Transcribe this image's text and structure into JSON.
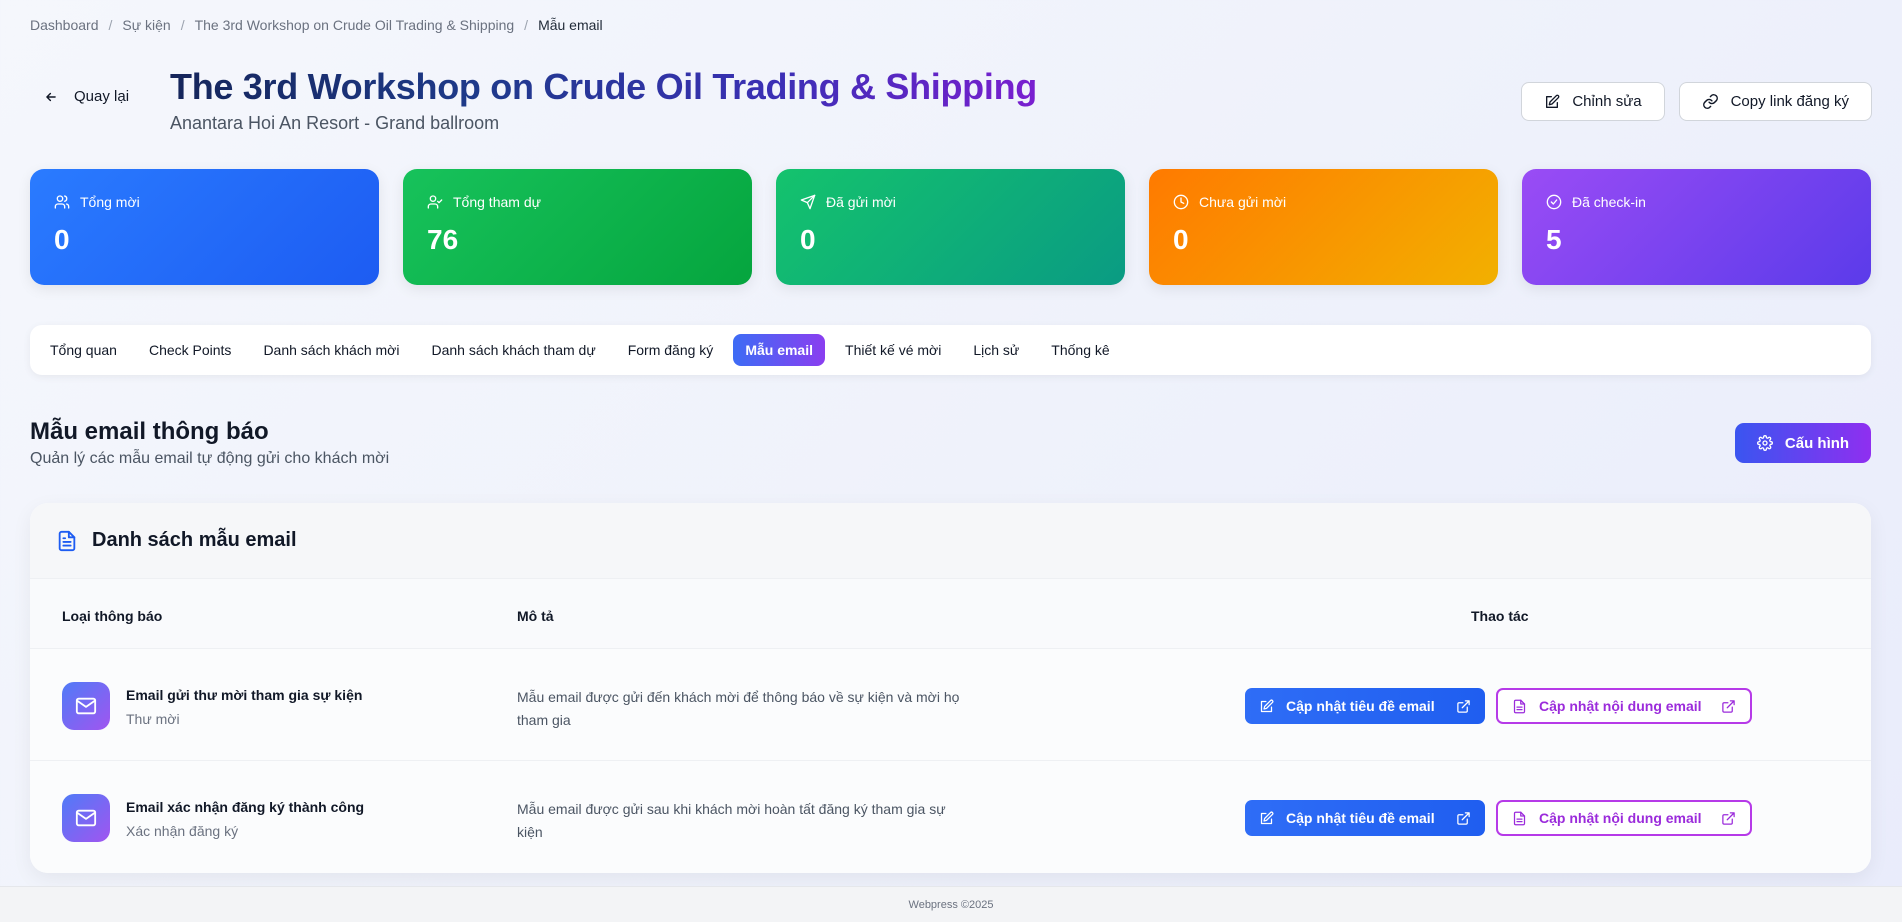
{
  "breadcrumb": [
    "Dashboard",
    "Sự kiện",
    "The 3rd Workshop on Crude Oil Trading & Shipping",
    "Mẫu email"
  ],
  "header": {
    "back_label": "Quay lại",
    "title": "The 3rd Workshop on Crude Oil Trading & Shipping",
    "subtitle": "Anantara Hoi An Resort - Grand ballroom",
    "edit_label": "Chỉnh sửa",
    "copy_link_label": "Copy link đăng ký"
  },
  "stats": [
    {
      "label": "Tổng mời",
      "value": "0",
      "icon": "users-icon",
      "color": "#2a7bff"
    },
    {
      "label": "Tổng tham dự",
      "value": "76",
      "icon": "user-check-icon",
      "color": "#17c25b"
    },
    {
      "label": "Đã gửi mời",
      "value": "0",
      "icon": "send-icon",
      "color": "#14c36d"
    },
    {
      "label": "Chưa gửi mời",
      "value": "0",
      "icon": "clock-icon",
      "color": "#ff7a00"
    },
    {
      "label": "Đã check-in",
      "value": "5",
      "icon": "check-circle-icon",
      "color": "#9a4cf5"
    }
  ],
  "tabs": [
    "Tổng quan",
    "Check Points",
    "Danh sách khách mời",
    "Danh sách khách tham dự",
    "Form đăng ký",
    "Mẫu email",
    "Thiết kế vé mời",
    "Lịch sử",
    "Thống kê"
  ],
  "active_tab": "Mẫu email",
  "section": {
    "title": "Mẫu email thông báo",
    "subtitle": "Quản lý các mẫu email tự động gửi cho khách mời",
    "config_label": "Cấu hình"
  },
  "table": {
    "title": "Danh sách mẫu email",
    "headers": {
      "type": "Loại thông báo",
      "desc": "Mô tả",
      "actions": "Thao tác"
    },
    "rows": [
      {
        "name": "Email gửi thư mời tham gia sự kiện",
        "type": "Thư mời",
        "desc": "Mẫu email được gửi đến khách mời để thông báo về sự kiện và mời họ tham gia",
        "update_subject": "Cập nhật tiêu đề email",
        "update_content": "Cập nhật nội dung email"
      },
      {
        "name": "Email xác nhận đăng ký thành công",
        "type": "Xác nhận đăng ký",
        "desc": "Mẫu email được gửi sau khi khách mời hoàn tất đăng ký tham gia sự kiện",
        "update_subject": "Cập nhật tiêu đề email",
        "update_content": "Cập nhật nội dung email"
      }
    ]
  },
  "footer": "Webpress ©2025"
}
